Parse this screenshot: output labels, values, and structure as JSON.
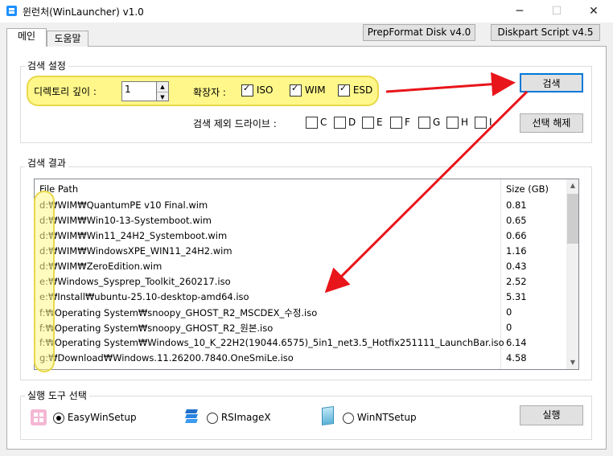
{
  "window": {
    "title": "윈런처(WinLauncher) v1.0",
    "minimize": "─",
    "maximize": "☐",
    "close": "✕"
  },
  "tabs": [
    {
      "label": "메인"
    },
    {
      "label": "도움말"
    }
  ],
  "top_buttons": {
    "prepformat": "PrepFormat Disk v4.0",
    "diskpart": "Diskpart Script v4.5"
  },
  "search": {
    "group_label": "검색 설정",
    "depth_label": "디렉토리 깊이 :",
    "depth_value": "1",
    "ext_label": "확장자 :",
    "ext": [
      {
        "label": "ISO",
        "checked": true
      },
      {
        "label": "WIM",
        "checked": true
      },
      {
        "label": "ESD",
        "checked": true
      }
    ],
    "search_button": "검색",
    "exclude_label": "검색 제외 드라이브 :",
    "drives": [
      "C",
      "D",
      "E",
      "F",
      "G",
      "H",
      "I"
    ],
    "deselect_button": "선택 해제"
  },
  "results": {
    "group_label": "검색 결과",
    "columns": [
      "File Path",
      "Size (GB)"
    ],
    "rows": [
      {
        "path": "d:₩WIM₩QuantumPE v10 Final.wim",
        "size": "0.81"
      },
      {
        "path": "d:₩WIM₩Win10-13-Systemboot.wim",
        "size": "0.65"
      },
      {
        "path": "d:₩WIM₩Win11_24H2_Systemboot.wim",
        "size": "0.66"
      },
      {
        "path": "d:₩WIM₩WindowsXPE_WIN11_24H2.wim",
        "size": "1.16"
      },
      {
        "path": "d:₩WIM₩ZeroEdition.wim",
        "size": "0.43"
      },
      {
        "path": "e:₩Windows_Sysprep_Toolkit_260217.iso",
        "size": "2.52"
      },
      {
        "path": "e:₩Install₩ubuntu-25.10-desktop-amd64.iso",
        "size": "5.31"
      },
      {
        "path": "f:₩Operating System₩snoopy_GHOST_R2_MSCDEX_수정.iso",
        "size": "0"
      },
      {
        "path": "f:₩Operating System₩snoopy_GHOST_R2_원본.iso",
        "size": "0"
      },
      {
        "path": "f:₩Operating System₩Windows_10_K_22H2(19044.6575)_5in1_net3.5_Hotfix251111_LaunchBar.iso",
        "size": "6.14"
      },
      {
        "path": "g:₩Download₩Windows.11.26200.7840.OneSmiLe.iso",
        "size": "4.58"
      }
    ]
  },
  "tools": {
    "group_label": "실행 도구 선택",
    "options": [
      {
        "label": "EasyWinSetup",
        "selected": true
      },
      {
        "label": "RSImageX",
        "selected": false
      },
      {
        "label": "WinNTSetup",
        "selected": false
      }
    ],
    "run_button": "실행"
  },
  "colors": {
    "highlight": "#fff78a",
    "arrow": "#e8151b"
  }
}
